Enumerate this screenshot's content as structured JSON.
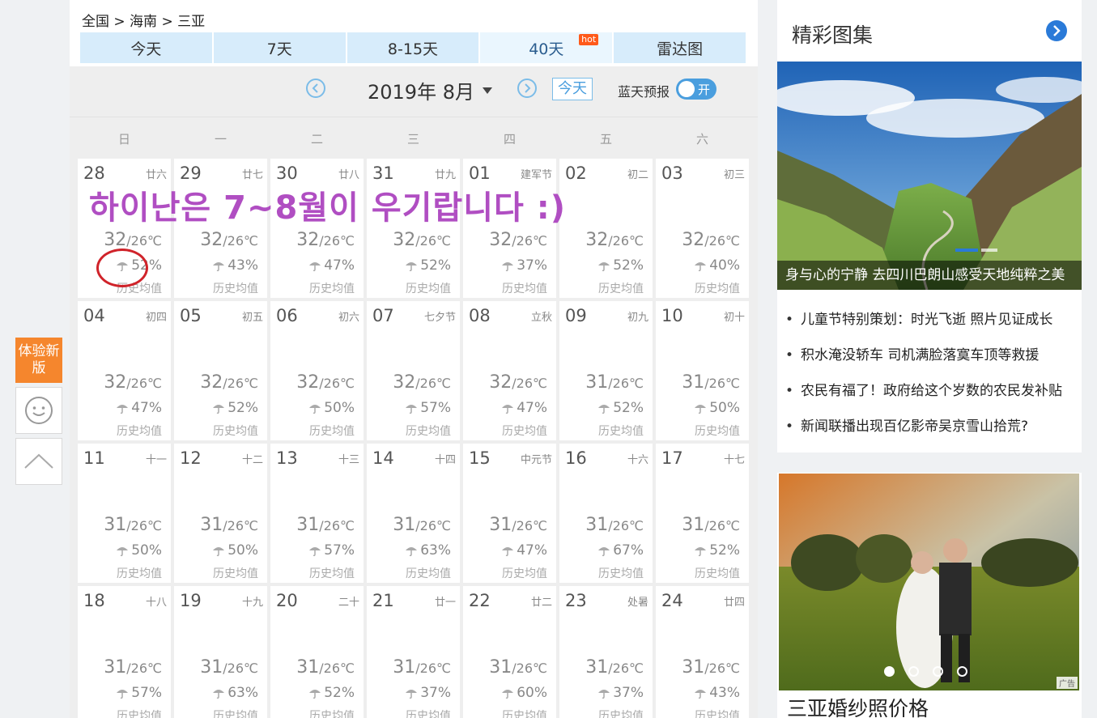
{
  "breadcrumb": "全国 > 海南 > 三亚",
  "tabs": [
    {
      "label": "今天"
    },
    {
      "label": "7天"
    },
    {
      "label": "8-15天"
    },
    {
      "label": "40天",
      "badge": "hot"
    },
    {
      "label": "雷达图"
    }
  ],
  "month_nav": {
    "title": "2019年 8月",
    "today_label": "今天",
    "bluesky_label": "蓝天预报",
    "toggle_label": "开"
  },
  "weekdays": [
    "日",
    "一",
    "二",
    "三",
    "四",
    "五",
    "六"
  ],
  "colors": {
    "accent": "#4a9ede",
    "tab_bg": "#d7ecfb",
    "overlay": "#b04ec2",
    "hot": "#ff5a1a"
  },
  "units": {
    "temp": "/26℃",
    "hist": "历史均值"
  },
  "days": [
    {
      "d": "28",
      "lunar": "廿六",
      "hi": "32",
      "lo": "/26℃",
      "rain": "52%"
    },
    {
      "d": "29",
      "lunar": "廿七",
      "hi": "32",
      "lo": "/26℃",
      "rain": "43%"
    },
    {
      "d": "30",
      "lunar": "廿八",
      "hi": "32",
      "lo": "/26℃",
      "rain": "47%"
    },
    {
      "d": "31",
      "lunar": "廿九",
      "hi": "32",
      "lo": "/26℃",
      "rain": "52%"
    },
    {
      "d": "01",
      "lunar": "建军节",
      "hi": "32",
      "lo": "/26℃",
      "rain": "37%"
    },
    {
      "d": "02",
      "lunar": "初二",
      "hi": "32",
      "lo": "/26℃",
      "rain": "52%"
    },
    {
      "d": "03",
      "lunar": "初三",
      "hi": "32",
      "lo": "/26℃",
      "rain": "40%"
    },
    {
      "d": "04",
      "lunar": "初四",
      "hi": "32",
      "lo": "/26℃",
      "rain": "47%"
    },
    {
      "d": "05",
      "lunar": "初五",
      "hi": "32",
      "lo": "/26℃",
      "rain": "52%"
    },
    {
      "d": "06",
      "lunar": "初六",
      "hi": "32",
      "lo": "/26℃",
      "rain": "50%"
    },
    {
      "d": "07",
      "lunar": "七夕节",
      "hi": "32",
      "lo": "/26℃",
      "rain": "57%"
    },
    {
      "d": "08",
      "lunar": "立秋",
      "hi": "32",
      "lo": "/26℃",
      "rain": "47%"
    },
    {
      "d": "09",
      "lunar": "初九",
      "hi": "31",
      "lo": "/26℃",
      "rain": "52%"
    },
    {
      "d": "10",
      "lunar": "初十",
      "hi": "31",
      "lo": "/26℃",
      "rain": "50%"
    },
    {
      "d": "11",
      "lunar": "十一",
      "hi": "31",
      "lo": "/26℃",
      "rain": "50%"
    },
    {
      "d": "12",
      "lunar": "十二",
      "hi": "31",
      "lo": "/26℃",
      "rain": "50%"
    },
    {
      "d": "13",
      "lunar": "十三",
      "hi": "31",
      "lo": "/26℃",
      "rain": "57%"
    },
    {
      "d": "14",
      "lunar": "十四",
      "hi": "31",
      "lo": "/26℃",
      "rain": "63%"
    },
    {
      "d": "15",
      "lunar": "中元节",
      "hi": "31",
      "lo": "/26℃",
      "rain": "47%"
    },
    {
      "d": "16",
      "lunar": "十六",
      "hi": "31",
      "lo": "/26℃",
      "rain": "67%"
    },
    {
      "d": "17",
      "lunar": "十七",
      "hi": "31",
      "lo": "/26℃",
      "rain": "52%"
    },
    {
      "d": "18",
      "lunar": "十八",
      "hi": "31",
      "lo": "/26℃",
      "rain": "57%"
    },
    {
      "d": "19",
      "lunar": "十九",
      "hi": "31",
      "lo": "/26℃",
      "rain": "63%"
    },
    {
      "d": "20",
      "lunar": "二十",
      "hi": "31",
      "lo": "/26℃",
      "rain": "52%"
    },
    {
      "d": "21",
      "lunar": "廿一",
      "hi": "31",
      "lo": "/26℃",
      "rain": "37%"
    },
    {
      "d": "22",
      "lunar": "廿二",
      "hi": "31",
      "lo": "/26℃",
      "rain": "60%"
    },
    {
      "d": "23",
      "lunar": "处暑",
      "hi": "31",
      "lo": "/26℃",
      "rain": "37%"
    },
    {
      "d": "24",
      "lunar": "廿四",
      "hi": "31",
      "lo": "/26℃",
      "rain": "43%"
    }
  ],
  "overlay_text": "하이난은 7~8월이 우기랍니다 :)",
  "float_tools": {
    "new_version": "体验新版"
  },
  "gallery": {
    "title": "精彩图集",
    "caption": "身与心的宁静 去四川巴朗山感受天地纯粹之美",
    "news": [
      "儿童节特别策划：时光飞逝 照片见证成长",
      "积水淹没轿车 司机满脸落寞车顶等救援",
      "农民有福了！政府给这个岁数的农民发补贴",
      "新闻联播出现百亿影帝吴京雪山拾荒?"
    ]
  },
  "ad": {
    "title": "三亚婚纱照价格",
    "tag": "广告",
    "dots": 4,
    "active_dot": 1
  }
}
